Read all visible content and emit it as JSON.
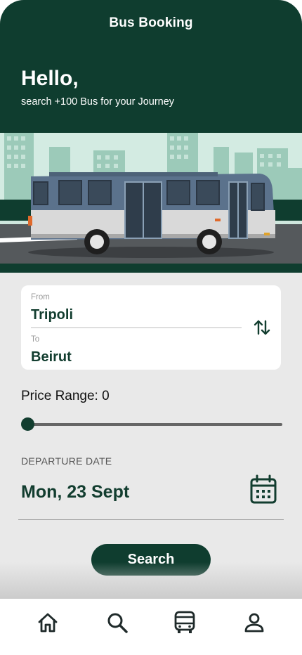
{
  "header": {
    "title": "Bus Booking",
    "greeting": "Hello,",
    "subtitle": "search +100 Bus for your Journey"
  },
  "route": {
    "from_label": "From",
    "from_value": "Tripoli",
    "to_label": "To",
    "to_value": "Beirut"
  },
  "price": {
    "label": "Price Range: 0",
    "value": 0
  },
  "departure": {
    "label": "DEPARTURE DATE",
    "date": "Mon, 23 Sept"
  },
  "actions": {
    "search_label": "Search"
  },
  "nav": {
    "items": [
      "home-icon",
      "search-icon",
      "bus-icon",
      "person-icon"
    ]
  },
  "colors": {
    "primary": "#0f3d2f",
    "background": "#e9e9e9",
    "card": "#ffffff"
  }
}
